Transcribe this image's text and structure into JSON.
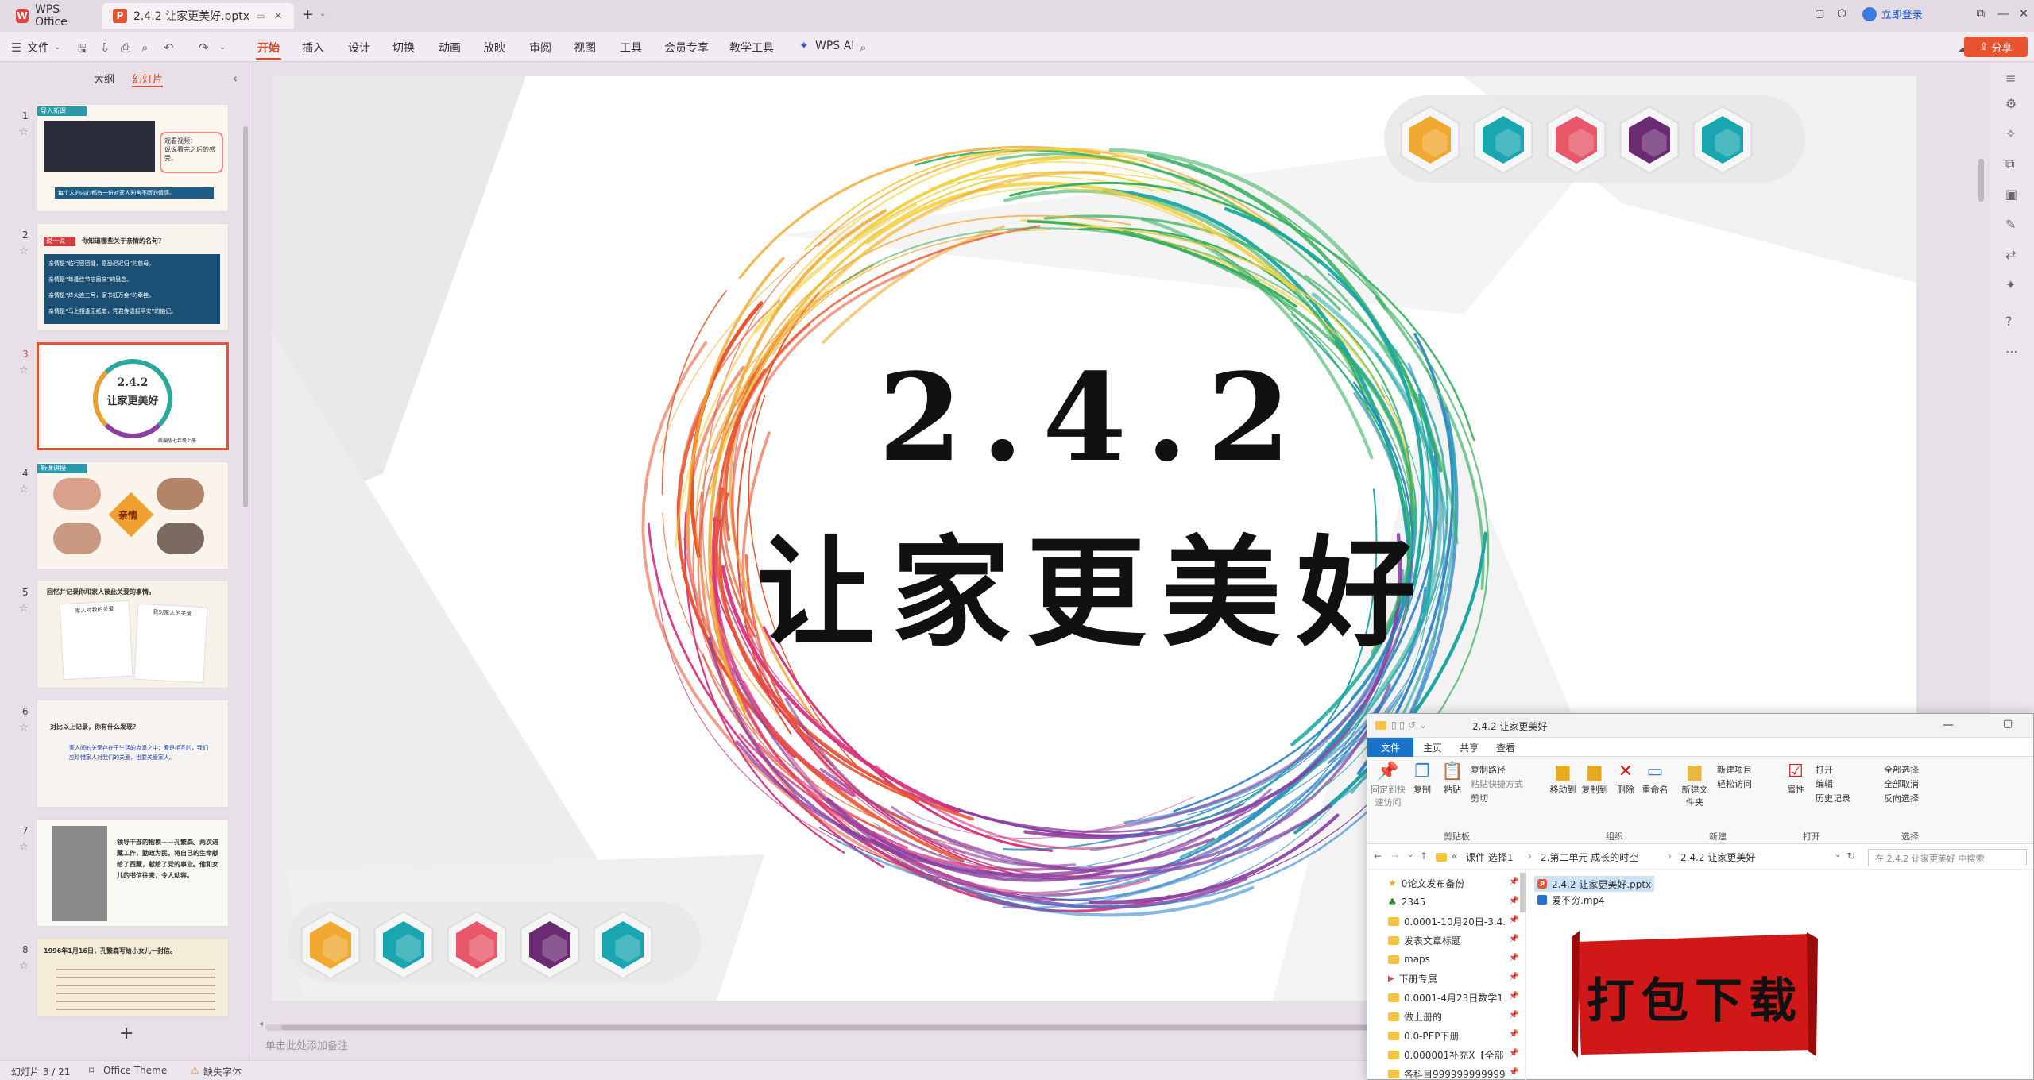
{
  "titlebar": {
    "home_tab": "WPS Office",
    "doc_tab": "2.4.2 让家更美好.pptx",
    "login": "立即登录"
  },
  "menu": {
    "file": "文件",
    "items": [
      "开始",
      "插入",
      "设计",
      "切换",
      "动画",
      "放映",
      "审阅",
      "视图",
      "工具",
      "会员专享",
      "教学工具"
    ],
    "ai": "WPS AI",
    "share": "分享"
  },
  "left_panel": {
    "tab_outline": "大纲",
    "tab_slides": "幻灯片",
    "slides": [
      {
        "num": "1",
        "lines": [
          "导入新课",
          "观看视频：",
          "说说看完之后",
          "的感受。",
          "每个人的内心都有一份对家人割舍不断的情感。"
        ]
      },
      {
        "num": "2",
        "lines": [
          "说一说",
          "你知道哪些关于亲情的名句？",
          "亲情是“临行密密缝，意恐迟迟归”的慈母。",
          "亲情是“每逢佳节倍思亲”的思念。",
          "亲情是“烽火连三月，家书抵万金”的牵挂。",
          "亲情是“马上相逢无纸笔，凭君传语报平安”的惦记。"
        ]
      },
      {
        "num": "3",
        "lines": [
          "2.4.2",
          "让家更美好",
          "统编版七年级上册"
        ]
      },
      {
        "num": "4",
        "lines": [
          "新课讲授",
          "亲情"
        ]
      },
      {
        "num": "5",
        "lines": [
          "回忆并记录你和家人彼此关爱的事情。",
          "家人对我的关爱",
          "我对家人的关爱"
        ]
      },
      {
        "num": "6",
        "lines": [
          "对比以上记录，你有什么发现？",
          "家人间的关爱存在于生活的点滴之中；爱是相互的，我们应珍惜家人对我们的关爱，也要关爱家人。"
        ]
      },
      {
        "num": "7",
        "lines": [
          "领导干部的楷模——孔繁森。两次进藏工作，勤政为民，将自己的生命献给了西藏，献给了党的事业。他和女儿的书信往来，令人动容。"
        ]
      },
      {
        "num": "8",
        "lines": [
          "1996年1月16日，孔繁森写给小女儿一封信。"
        ]
      }
    ]
  },
  "slide": {
    "number": "2.4.2",
    "title": "让家更美好"
  },
  "notes_placeholder": "单击此处添加备注",
  "status": {
    "slide_pos": "幻灯片 3 / 21",
    "theme": "Office Theme",
    "missing_font": "缺失字体"
  },
  "explorer": {
    "title": "2.4.2 让家更美好",
    "tabs": [
      "文件",
      "主页",
      "共享",
      "查看"
    ],
    "ribbon": {
      "pin": "固定到快速访问",
      "copy": "复制",
      "paste": "粘贴",
      "copy_path": "复制路径",
      "paste_shortcut": "粘贴快捷方式",
      "cut": "剪切",
      "group_clipboard": "剪贴板",
      "move_to": "移动到",
      "copy_to": "复制到",
      "delete": "删除",
      "rename": "重命名",
      "group_organize": "组织",
      "new_folder": "新建文件夹",
      "new_item": "新建项目",
      "easy_access": "轻松访问",
      "group_new": "新建",
      "properties": "属性",
      "open": "打开",
      "edit": "编辑",
      "history": "历史记录",
      "group_open": "打开",
      "select_all": "全部选择",
      "select_none": "全部取消",
      "invert": "反向选择",
      "group_select": "选择"
    },
    "breadcrumb": [
      "课件 选择1",
      "2.第二单元 成长的时空",
      "2.4.2 让家更美好"
    ],
    "search_placeholder": "在 2.4.2 让家更美好 中搜索",
    "nav": [
      "0论文发布备份",
      "2345",
      "0.0001-10月20日-3.4.",
      "发表文章标题",
      "maps",
      "下册专属",
      "0.0001-4月23日数学1",
      "做上册的",
      "0.0-PEP下册",
      "0.000001补充X【全部",
      "各科目999999999999"
    ],
    "files": [
      "2.4.2 让家更美好.pptx",
      "爱不穷.mp4"
    ]
  },
  "download_badge": "打包下载",
  "colors": {
    "accent": "#d44a2e",
    "hex": [
      "#f0a830",
      "#1aa6b0",
      "#e8586a",
      "#6a2b72",
      "#1aa6b0"
    ]
  }
}
